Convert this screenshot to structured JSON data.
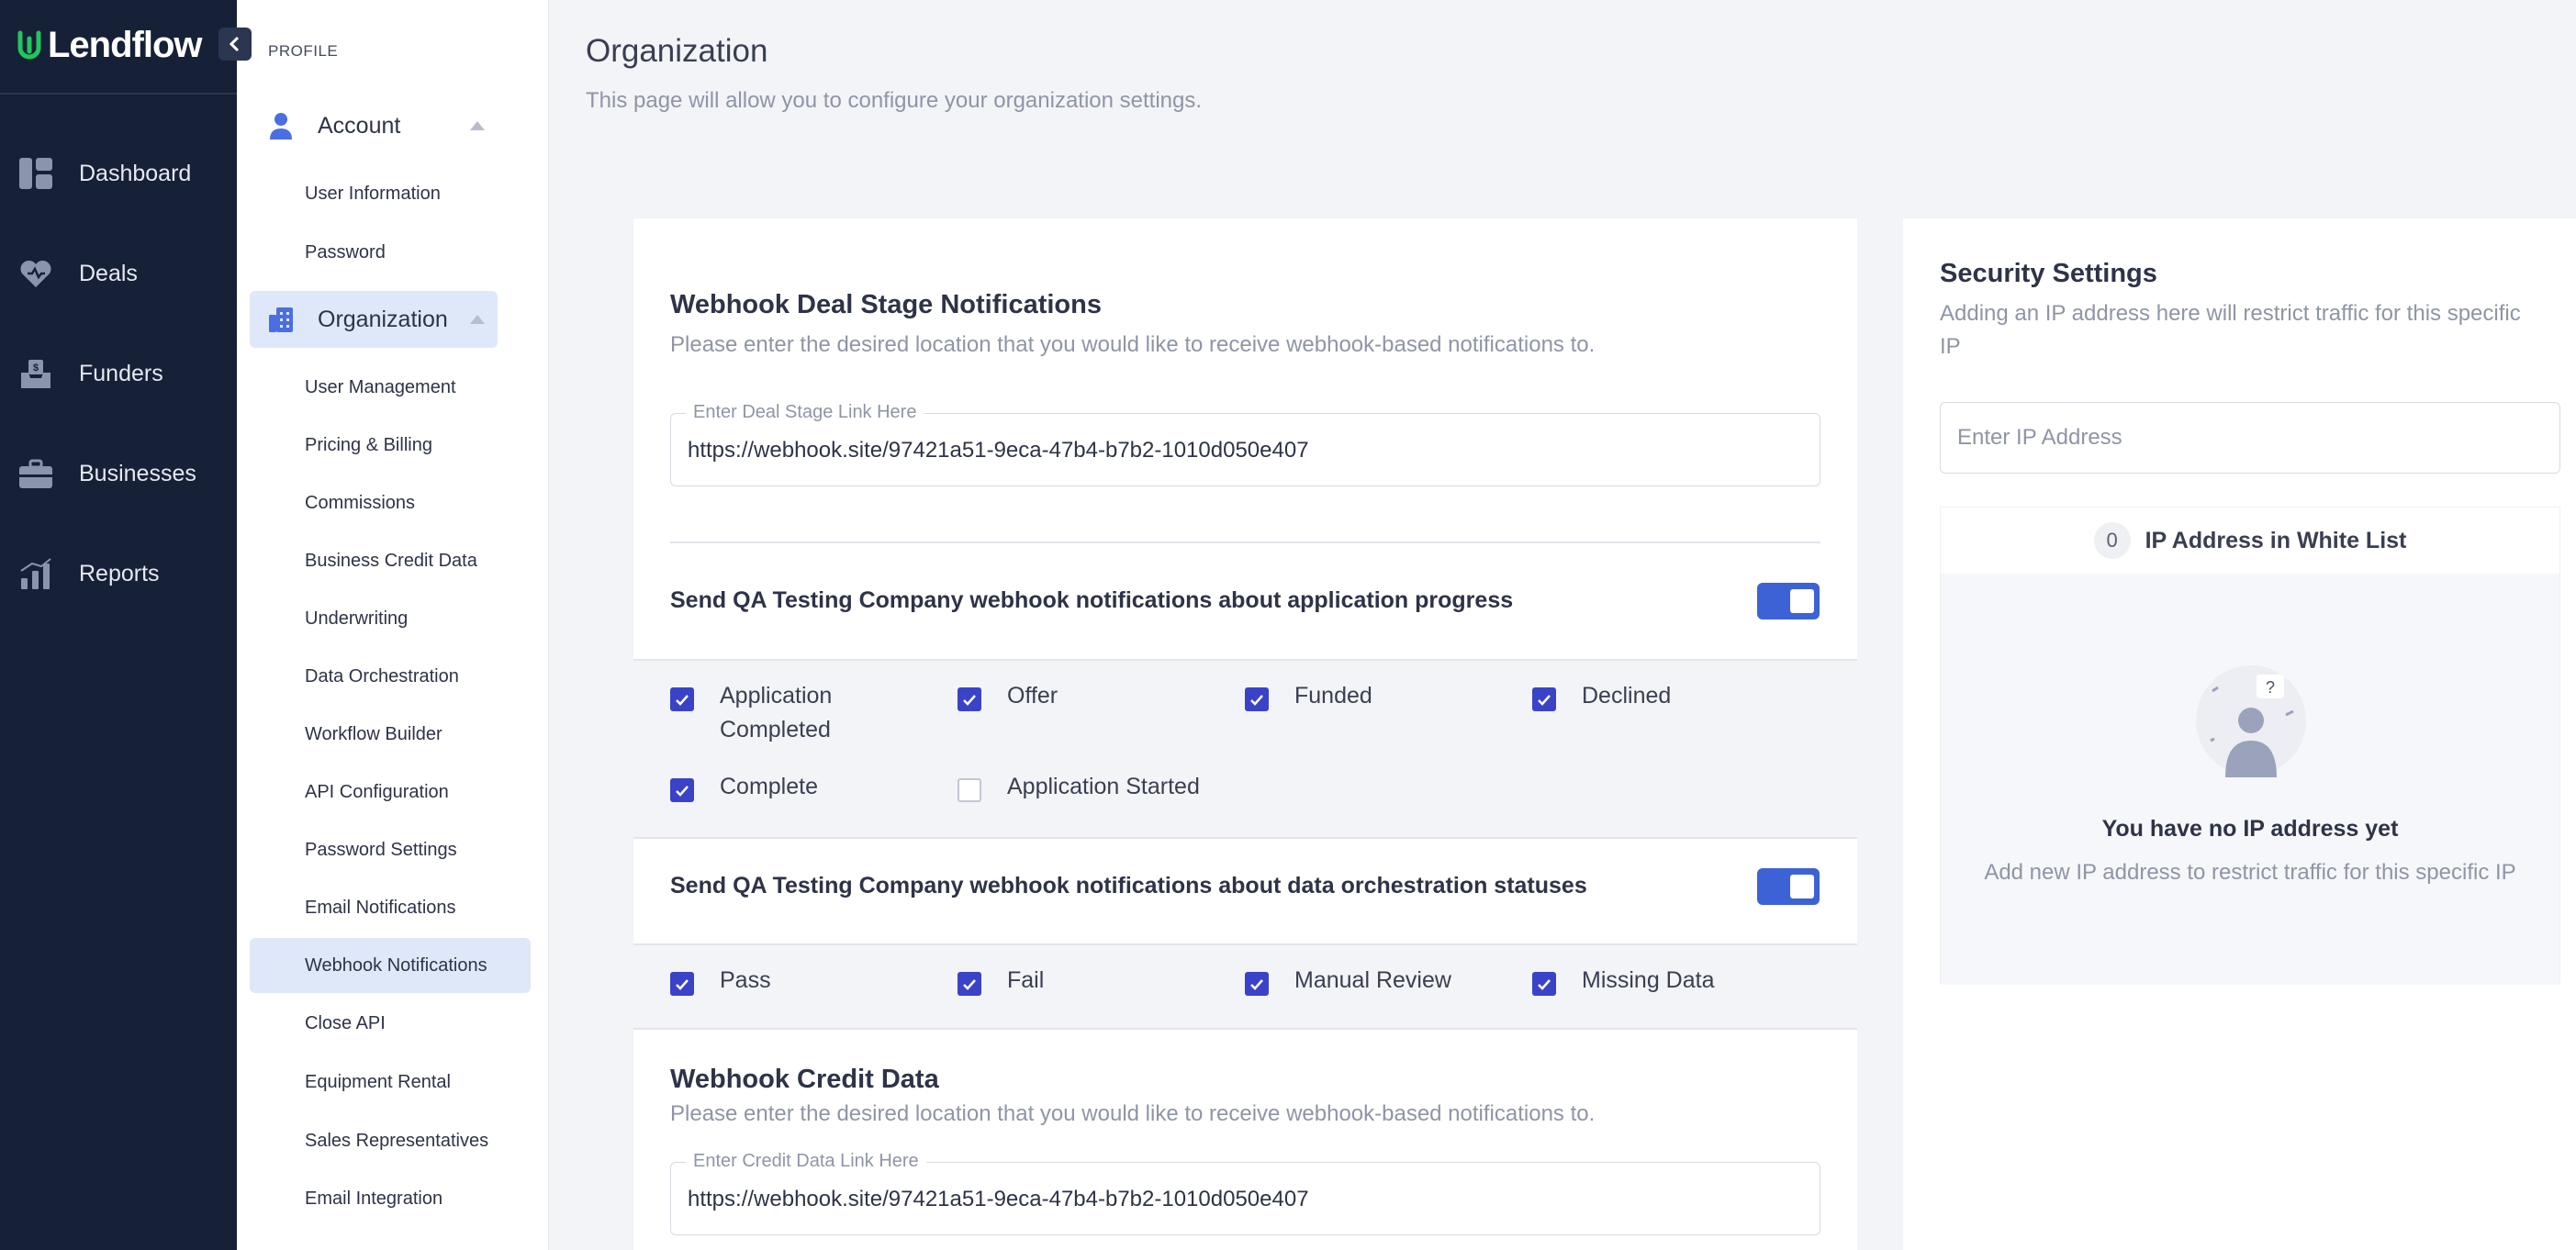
{
  "brand": {
    "name": "Lendflow"
  },
  "nav": {
    "items": [
      {
        "label": "Dashboard",
        "icon": "dashboard-icon"
      },
      {
        "label": "Deals",
        "icon": "deals-icon"
      },
      {
        "label": "Funders",
        "icon": "funders-icon"
      },
      {
        "label": "Businesses",
        "icon": "briefcase-icon"
      },
      {
        "label": "Reports",
        "icon": "reports-icon"
      }
    ]
  },
  "submenu": {
    "section_label": "PROFILE",
    "account": {
      "label": "Account",
      "items": [
        "User Information",
        "Password"
      ]
    },
    "organization": {
      "label": "Organization",
      "items": [
        "User Management",
        "Pricing & Billing",
        "Commissions",
        "Business Credit Data",
        "Underwriting",
        "Data Orchestration",
        "Workflow Builder",
        "API Configuration",
        "Password Settings",
        "Email Notifications",
        "Webhook Notifications",
        "Close API",
        "Equipment Rental",
        "Sales Representatives",
        "Email Integration"
      ],
      "active_item": "Webhook Notifications"
    }
  },
  "page": {
    "title": "Organization",
    "subtitle": "This page will allow you to configure your organization settings."
  },
  "webhook_deal": {
    "title": "Webhook Deal Stage Notifications",
    "subtitle": "Please enter the desired location that you would like to receive webhook-based notifications to.",
    "field_label": "Enter Deal Stage Link Here",
    "field_value": "https://webhook.site/97421a51-9eca-47b4-b7b2-1010d050e407"
  },
  "app_progress": {
    "label": "Send QA Testing Company webhook notifications about application progress",
    "enabled": true,
    "options": [
      {
        "label": "Application Completed",
        "checked": true
      },
      {
        "label": "Offer",
        "checked": true
      },
      {
        "label": "Funded",
        "checked": true
      },
      {
        "label": "Declined",
        "checked": true
      },
      {
        "label": "Complete",
        "checked": true
      },
      {
        "label": "Application Started",
        "checked": false
      }
    ]
  },
  "data_orch": {
    "label": "Send QA Testing Company webhook notifications about data orchestration statuses",
    "enabled": true,
    "options": [
      {
        "label": "Pass",
        "checked": true
      },
      {
        "label": "Fail",
        "checked": true
      },
      {
        "label": "Manual Review",
        "checked": true
      },
      {
        "label": "Missing Data",
        "checked": true
      }
    ]
  },
  "webhook_credit": {
    "title": "Webhook Credit Data",
    "subtitle": "Please enter the desired location that you would like to receive webhook-based notifications to.",
    "field_label": "Enter Credit Data Link Here",
    "field_value": "https://webhook.site/97421a51-9eca-47b4-b7b2-1010d050e407"
  },
  "security": {
    "title": "Security Settings",
    "subtitle": "Adding an IP address here will restrict traffic for this specific IP",
    "ip_placeholder": "Enter IP Address",
    "whitelist_count": "0",
    "whitelist_label": "IP Address in White List",
    "empty_title": "You have no IP address yet",
    "empty_sub": "Add new IP address to restrict traffic for this specific IP"
  },
  "colors": {
    "nav_bg": "#162036",
    "accent": "#3c62d6",
    "checkbox": "#3a43c7",
    "active_bg": "#dfe8f9",
    "brand_green": "#22c55e"
  }
}
